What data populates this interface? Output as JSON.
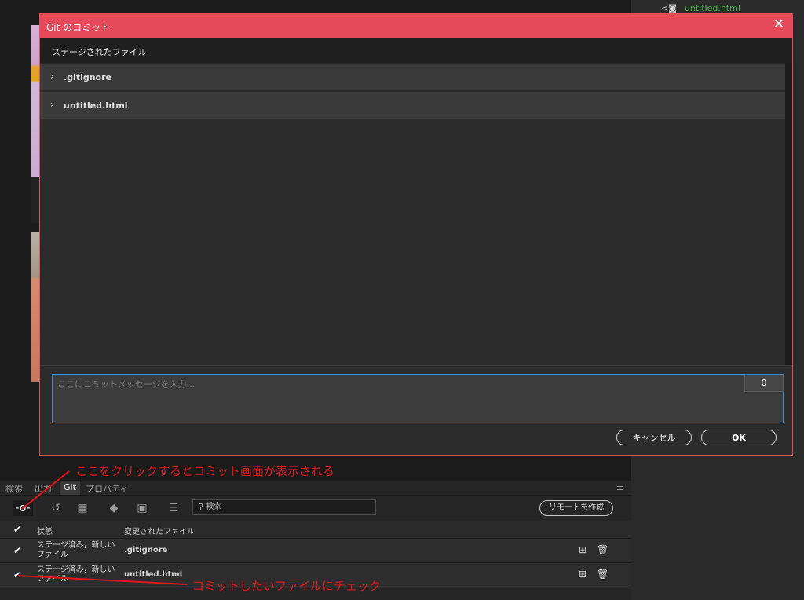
{
  "right_panel": {
    "filename": "untitled.html",
    "file_icon": "code-file-icon"
  },
  "dialog": {
    "title": "Git のコミット",
    "staged_title": "ステージされたファイル",
    "staged_files": [
      ".gitignore",
      "untitled.html"
    ],
    "message_placeholder": "ここにコミットメッセージを入力...",
    "char_count": "0",
    "cancel_label": "キャンセル",
    "ok_label": "OK"
  },
  "bottom": {
    "tabs": [
      "検索",
      "出力",
      "Git",
      "プロパティ"
    ],
    "active_tab": "Git",
    "search_placeholder": "検索",
    "remote_button": "リモートを作成",
    "headers": {
      "status": "状態",
      "file": "変更されたファイル"
    },
    "rows": [
      {
        "status_line1": "ステージ済み，新しい",
        "status_line2": "ファイル",
        "file": ".gitignore"
      },
      {
        "status_line1": "ステージ済み，新しい",
        "status_line2": "ファイル",
        "file": "untitled.html"
      }
    ]
  },
  "annotations": {
    "commit_hint": "ここをクリックするとコミット画面が表示される",
    "check_hint": "コミットしたいファイルにチェック"
  },
  "colors": {
    "accent": "#e64a5a",
    "annotation": "#e0161c",
    "focus": "#3d8bd1",
    "file_green": "#4caf50"
  }
}
